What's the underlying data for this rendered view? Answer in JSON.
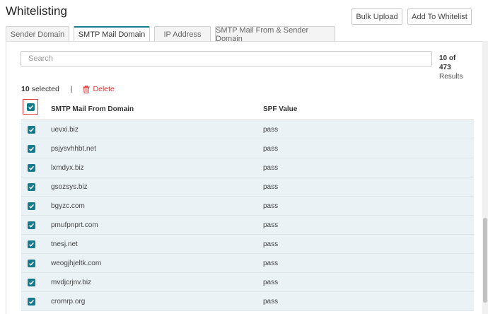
{
  "page_title": "Whitelisting",
  "toolbar": {
    "bulk_upload_label": "Bulk Upload",
    "add_label": "Add To Whitelist"
  },
  "tabs": [
    {
      "label": "Sender Domain",
      "active": false
    },
    {
      "label": "SMTP Mail Domain",
      "active": true
    },
    {
      "label": "IP Address",
      "active": false
    },
    {
      "label": "SMTP Mail From & Sender Domain",
      "active": false
    }
  ],
  "search": {
    "placeholder": "Search",
    "value": ""
  },
  "results": {
    "count_label": "10 of",
    "total": "473",
    "suffix": "Results"
  },
  "selection": {
    "count": "10",
    "label": "selected",
    "separator": "|",
    "delete_label": "Delete"
  },
  "table": {
    "columns": [
      "SMTP Mail From Domain",
      "SPF Value"
    ],
    "rows": [
      {
        "domain": "uevxi.biz",
        "spf": "pass",
        "checked": true
      },
      {
        "domain": "psjysvhhbt.net",
        "spf": "pass",
        "checked": true
      },
      {
        "domain": "lxmdyx.biz",
        "spf": "pass",
        "checked": true
      },
      {
        "domain": "gsozsys.biz",
        "spf": "pass",
        "checked": true
      },
      {
        "domain": "bgyzc.com",
        "spf": "pass",
        "checked": true
      },
      {
        "domain": "pmufpnprt.com",
        "spf": "pass",
        "checked": true
      },
      {
        "domain": "tnesj.net",
        "spf": "pass",
        "checked": true
      },
      {
        "domain": "weogjhjeltk.com",
        "spf": "pass",
        "checked": true
      },
      {
        "domain": "mvdjcrjnv.biz",
        "spf": "pass",
        "checked": true
      },
      {
        "domain": "cromrp.org",
        "spf": "pass",
        "checked": true
      }
    ]
  },
  "colors": {
    "accent": "#157a8c",
    "delete": "#d53a3a",
    "row_bg": "#eaf2f6",
    "highlight_border": "#e03b3b"
  },
  "icons": {
    "checkbox": "checkmark-icon",
    "delete": "trash-icon"
  }
}
